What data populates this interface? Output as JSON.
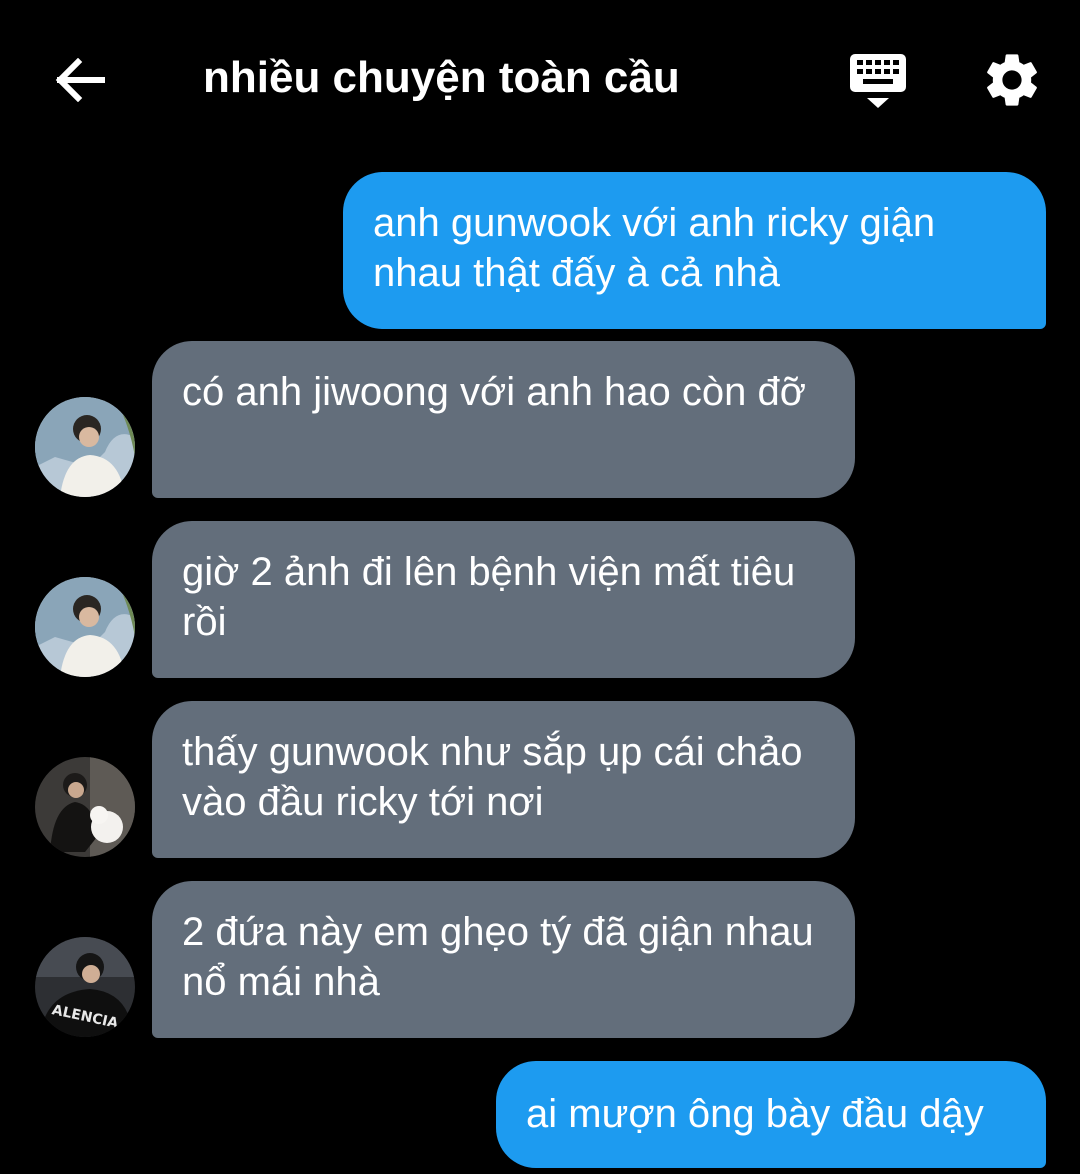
{
  "header": {
    "title": "nhiều chuyện toàn cầu",
    "back_icon": "arrow-left-icon",
    "keyboard_icon": "keyboard-icon",
    "settings_icon": "gear-icon"
  },
  "messages": [
    {
      "direction": "outgoing",
      "text": "anh gunwook với anh ricky giận nhau thật đấy à cả nhà"
    },
    {
      "direction": "incoming",
      "avatar": "avatar-user-1",
      "text": "có anh jiwoong với anh hao còn đỡ"
    },
    {
      "direction": "incoming",
      "avatar": "avatar-user-1",
      "text": "giờ 2 ảnh đi lên bệnh viện mất tiêu rồi"
    },
    {
      "direction": "incoming",
      "avatar": "avatar-user-2",
      "text": "thấy gunwook như sắp ụp cái chảo vào đầu ricky tới nơi"
    },
    {
      "direction": "incoming",
      "avatar": "avatar-user-3",
      "text": "2 đứa này em ghẹo tý đã giận nhau nổ mái nhà",
      "avatar_logo_text": "ALENCIA"
    },
    {
      "direction": "outgoing",
      "text": "ai mượn ông bày đầu dậy"
    }
  ],
  "colors": {
    "background": "#000000",
    "outgoing_bubble": "#1d9bf0",
    "incoming_bubble": "#636e7b",
    "text": "#ffffff"
  }
}
